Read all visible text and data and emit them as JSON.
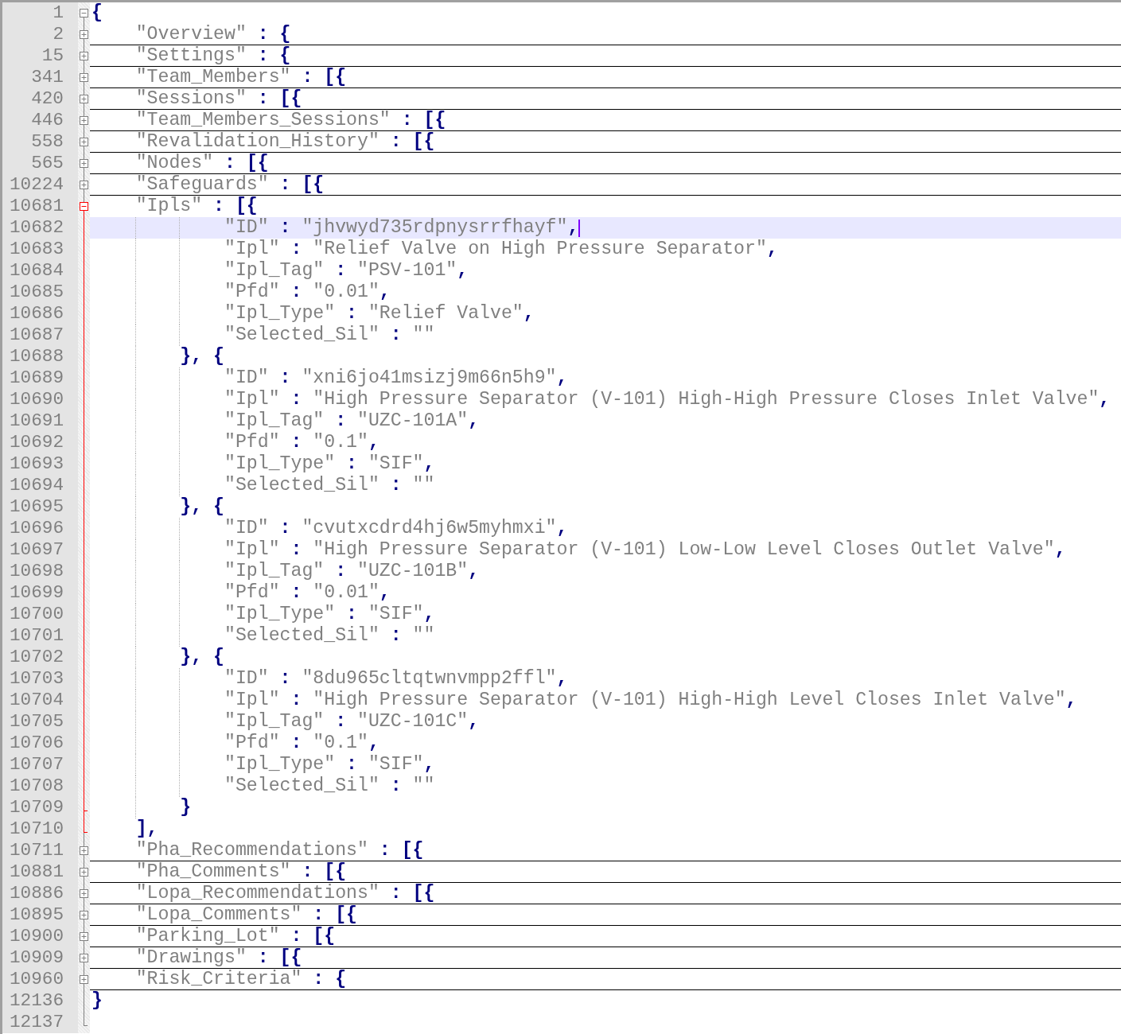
{
  "editor": {
    "lines": [
      {
        "number": "1",
        "text": "{",
        "kind": "open",
        "active": false,
        "current": false
      },
      {
        "number": "2",
        "text": "    \"Overview\" : {",
        "kind": "closed",
        "active": false,
        "current": false
      },
      {
        "number": "15",
        "text": "    \"Settings\" : {",
        "kind": "closed",
        "active": false,
        "current": false
      },
      {
        "number": "341",
        "text": "    \"Team_Members\" : [{",
        "kind": "closed",
        "active": false,
        "current": false
      },
      {
        "number": "420",
        "text": "    \"Sessions\" : [{",
        "kind": "closed",
        "active": false,
        "current": false
      },
      {
        "number": "446",
        "text": "    \"Team_Members_Sessions\" : [{",
        "kind": "closed",
        "active": false,
        "current": false
      },
      {
        "number": "558",
        "text": "    \"Revalidation_History\" : [{",
        "kind": "closed",
        "active": false,
        "current": false
      },
      {
        "number": "565",
        "text": "    \"Nodes\" : [{",
        "kind": "closed",
        "active": false,
        "current": false
      },
      {
        "number": "10224",
        "text": "    \"Safeguards\" : [{",
        "kind": "closed",
        "active": false,
        "current": false
      },
      {
        "number": "10681",
        "text": "    \"Ipls\" : [{",
        "kind": "open",
        "active": true,
        "current": false
      },
      {
        "number": "10682",
        "text": "            \"ID\" : \"jhvwyd735rdpnysrrfhayf\",",
        "kind": "body",
        "active": true,
        "current": true
      },
      {
        "number": "10683",
        "text": "            \"Ipl\" : \"Relief Valve on High Pressure Separator\",",
        "kind": "body",
        "active": true,
        "current": false
      },
      {
        "number": "10684",
        "text": "            \"Ipl_Tag\" : \"PSV-101\",",
        "kind": "body",
        "active": true,
        "current": false
      },
      {
        "number": "10685",
        "text": "            \"Pfd\" : \"0.01\",",
        "kind": "body",
        "active": true,
        "current": false
      },
      {
        "number": "10686",
        "text": "            \"Ipl_Type\" : \"Relief Valve\",",
        "kind": "body",
        "active": true,
        "current": false
      },
      {
        "number": "10687",
        "text": "            \"Selected_Sil\" : \"\"",
        "kind": "body",
        "active": true,
        "current": false
      },
      {
        "number": "10688",
        "text": "        }, {",
        "kind": "body",
        "active": true,
        "current": false
      },
      {
        "number": "10689",
        "text": "            \"ID\" : \"xni6jo41msizj9m66n5h9\",",
        "kind": "body",
        "active": true,
        "current": false
      },
      {
        "number": "10690",
        "text": "            \"Ipl\" : \"High Pressure Separator (V-101) High-High Pressure Closes Inlet Valve\",",
        "kind": "body",
        "active": true,
        "current": false
      },
      {
        "number": "10691",
        "text": "            \"Ipl_Tag\" : \"UZC-101A\",",
        "kind": "body",
        "active": true,
        "current": false
      },
      {
        "number": "10692",
        "text": "            \"Pfd\" : \"0.1\",",
        "kind": "body",
        "active": true,
        "current": false
      },
      {
        "number": "10693",
        "text": "            \"Ipl_Type\" : \"SIF\",",
        "kind": "body",
        "active": true,
        "current": false
      },
      {
        "number": "10694",
        "text": "            \"Selected_Sil\" : \"\"",
        "kind": "body",
        "active": true,
        "current": false
      },
      {
        "number": "10695",
        "text": "        }, {",
        "kind": "body",
        "active": true,
        "current": false
      },
      {
        "number": "10696",
        "text": "            \"ID\" : \"cvutxcdrd4hj6w5myhmxi\",",
        "kind": "body",
        "active": true,
        "current": false
      },
      {
        "number": "10697",
        "text": "            \"Ipl\" : \"High Pressure Separator (V-101) Low-Low Level Closes Outlet Valve\",",
        "kind": "body",
        "active": true,
        "current": false
      },
      {
        "number": "10698",
        "text": "            \"Ipl_Tag\" : \"UZC-101B\",",
        "kind": "body",
        "active": true,
        "current": false
      },
      {
        "number": "10699",
        "text": "            \"Pfd\" : \"0.01\",",
        "kind": "body",
        "active": true,
        "current": false
      },
      {
        "number": "10700",
        "text": "            \"Ipl_Type\" : \"SIF\",",
        "kind": "body",
        "active": true,
        "current": false
      },
      {
        "number": "10701",
        "text": "            \"Selected_Sil\" : \"\"",
        "kind": "body",
        "active": true,
        "current": false
      },
      {
        "number": "10702",
        "text": "        }, {",
        "kind": "body",
        "active": true,
        "current": false
      },
      {
        "number": "10703",
        "text": "            \"ID\" : \"8du965cltqtwnvmpp2ffl\",",
        "kind": "body",
        "active": true,
        "current": false
      },
      {
        "number": "10704",
        "text": "            \"Ipl\" : \"High Pressure Separator (V-101) High-High Level Closes Inlet Valve\",",
        "kind": "body",
        "active": true,
        "current": false
      },
      {
        "number": "10705",
        "text": "            \"Ipl_Tag\" : \"UZC-101C\",",
        "kind": "body",
        "active": true,
        "current": false
      },
      {
        "number": "10706",
        "text": "            \"Pfd\" : \"0.1\",",
        "kind": "body",
        "active": true,
        "current": false
      },
      {
        "number": "10707",
        "text": "            \"Ipl_Type\" : \"SIF\",",
        "kind": "body",
        "active": true,
        "current": false
      },
      {
        "number": "10708",
        "text": "            \"Selected_Sil\" : \"\"",
        "kind": "body",
        "active": true,
        "current": false
      },
      {
        "number": "10709",
        "text": "        }",
        "kind": "tick",
        "active": true,
        "current": false
      },
      {
        "number": "10710",
        "text": "    ],",
        "kind": "end",
        "active": true,
        "current": false
      },
      {
        "number": "10711",
        "text": "    \"Pha_Recommendations\" : [{",
        "kind": "closed",
        "active": false,
        "current": false
      },
      {
        "number": "10881",
        "text": "    \"Pha_Comments\" : [{",
        "kind": "closed",
        "active": false,
        "current": false
      },
      {
        "number": "10886",
        "text": "    \"Lopa_Recommendations\" : [{",
        "kind": "closed",
        "active": false,
        "current": false
      },
      {
        "number": "10895",
        "text": "    \"Lopa_Comments\" : [{",
        "kind": "closed",
        "active": false,
        "current": false
      },
      {
        "number": "10900",
        "text": "    \"Parking_Lot\" : [{",
        "kind": "closed",
        "active": false,
        "current": false
      },
      {
        "number": "10909",
        "text": "    \"Drawings\" : [{",
        "kind": "closed",
        "active": false,
        "current": false
      },
      {
        "number": "10960",
        "text": "    \"Risk_Criteria\" : {",
        "kind": "closed",
        "active": false,
        "current": false
      },
      {
        "number": "12136",
        "text": "}",
        "kind": "body",
        "active": false,
        "current": false
      },
      {
        "number": "12137",
        "kind": "end",
        "active": false,
        "current": false
      }
    ]
  }
}
